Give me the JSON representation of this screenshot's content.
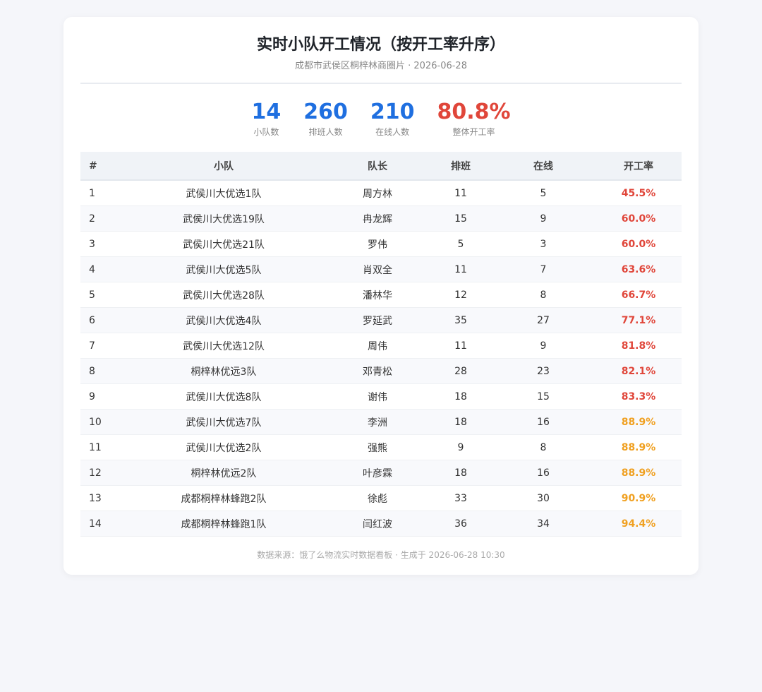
{
  "header": {
    "title": "实时小队开工情况（按开工率升序）",
    "subtitle": "成都市武侯区桐梓林商圈片 · 2026-06-28"
  },
  "stats": [
    {
      "value": "14",
      "label": "小队数",
      "tone": "primary"
    },
    {
      "value": "260",
      "label": "排班人数",
      "tone": "primary"
    },
    {
      "value": "210",
      "label": "在线人数",
      "tone": "primary"
    },
    {
      "value": "80.8%",
      "label": "整体开工率",
      "tone": "danger"
    }
  ],
  "colors": {
    "primary": "#1f6fe0",
    "danger": "#e0463a",
    "warning": "#f0a020"
  },
  "table": {
    "columns": [
      "#",
      "小队",
      "队长",
      "排班",
      "在线",
      "开工率"
    ],
    "rows": [
      {
        "idx": "1",
        "team": "武侯川大优选1队",
        "leader": "周方林",
        "shift": "11",
        "online": "5",
        "rate": "45.5%",
        "level": "red"
      },
      {
        "idx": "2",
        "team": "武侯川大优选19队",
        "leader": "冉龙辉",
        "shift": "15",
        "online": "9",
        "rate": "60.0%",
        "level": "red"
      },
      {
        "idx": "3",
        "team": "武侯川大优选21队",
        "leader": "罗伟",
        "shift": "5",
        "online": "3",
        "rate": "60.0%",
        "level": "red"
      },
      {
        "idx": "4",
        "team": "武侯川大优选5队",
        "leader": "肖双全",
        "shift": "11",
        "online": "7",
        "rate": "63.6%",
        "level": "red"
      },
      {
        "idx": "5",
        "team": "武侯川大优选28队",
        "leader": "潘林华",
        "shift": "12",
        "online": "8",
        "rate": "66.7%",
        "level": "red"
      },
      {
        "idx": "6",
        "team": "武侯川大优选4队",
        "leader": "罗延武",
        "shift": "35",
        "online": "27",
        "rate": "77.1%",
        "level": "red"
      },
      {
        "idx": "7",
        "team": "武侯川大优选12队",
        "leader": "周伟",
        "shift": "11",
        "online": "9",
        "rate": "81.8%",
        "level": "red"
      },
      {
        "idx": "8",
        "team": "桐梓林优远3队",
        "leader": "邓青松",
        "shift": "28",
        "online": "23",
        "rate": "82.1%",
        "level": "red"
      },
      {
        "idx": "9",
        "team": "武侯川大优选8队",
        "leader": "谢伟",
        "shift": "18",
        "online": "15",
        "rate": "83.3%",
        "level": "red"
      },
      {
        "idx": "10",
        "team": "武侯川大优选7队",
        "leader": "李洲",
        "shift": "18",
        "online": "16",
        "rate": "88.9%",
        "level": "orange"
      },
      {
        "idx": "11",
        "team": "武侯川大优选2队",
        "leader": "强熊",
        "shift": "9",
        "online": "8",
        "rate": "88.9%",
        "level": "orange"
      },
      {
        "idx": "12",
        "team": "桐梓林优远2队",
        "leader": "叶彦霖",
        "shift": "18",
        "online": "16",
        "rate": "88.9%",
        "level": "orange"
      },
      {
        "idx": "13",
        "team": "成都桐梓林蜂跑2队",
        "leader": "徐彪",
        "shift": "33",
        "online": "30",
        "rate": "90.9%",
        "level": "orange"
      },
      {
        "idx": "14",
        "team": "成都桐梓林蜂跑1队",
        "leader": "闫红波",
        "shift": "36",
        "online": "34",
        "rate": "94.4%",
        "level": "orange"
      }
    ]
  },
  "footer": {
    "text": "数据来源：饿了么物流实时数据看板 · 生成于 2026-06-28 10:30"
  }
}
